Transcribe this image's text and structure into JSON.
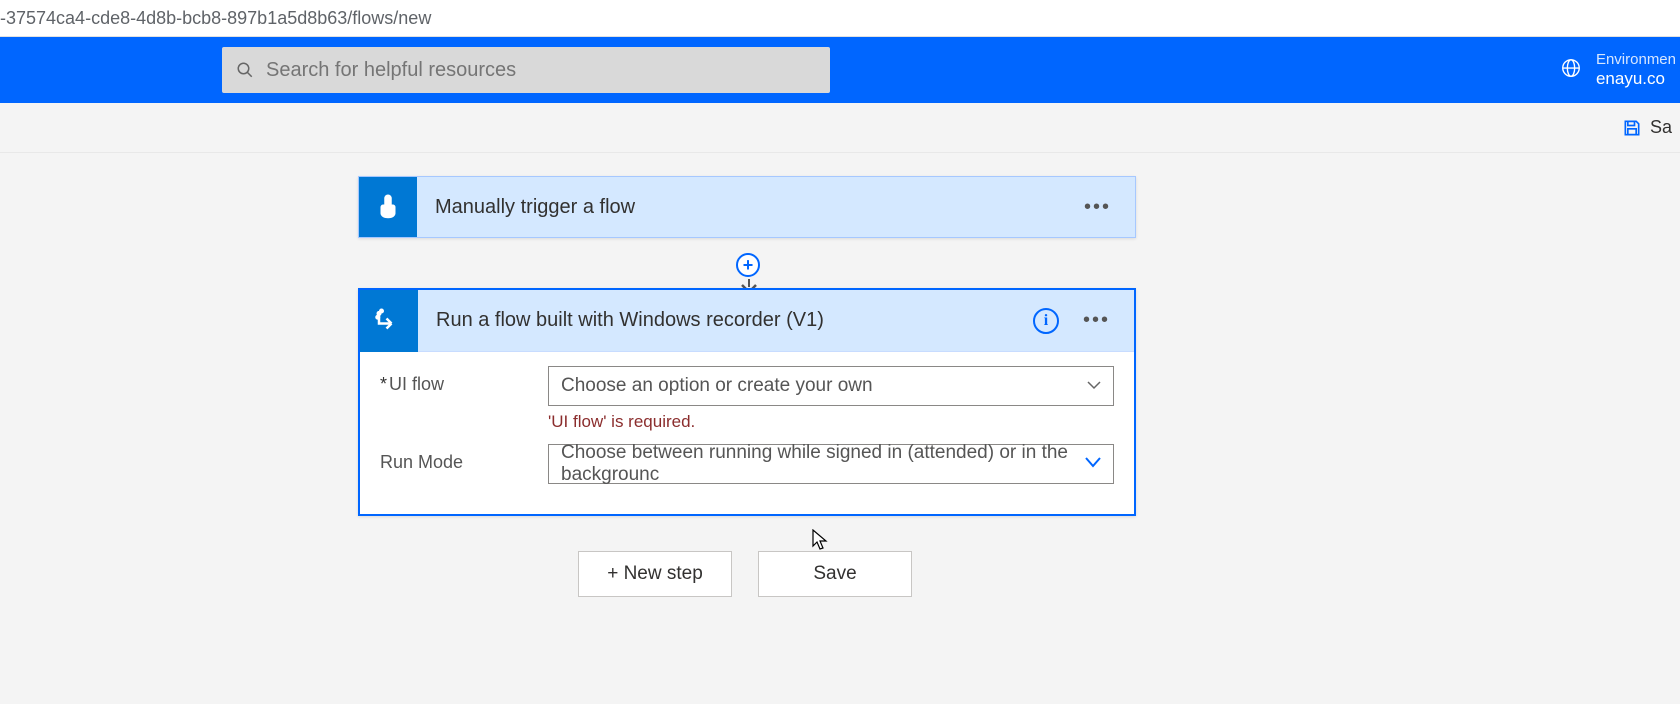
{
  "url_fragment": "-37574ca4-cde8-4d8b-bcb8-897b1a5d8b63/flows/new",
  "header": {
    "search_placeholder": "Search for helpful resources",
    "env_label": "Environmen",
    "env_value": "enayu.co"
  },
  "toolbar": {
    "save_label": "Sa"
  },
  "trigger": {
    "title": "Manually trigger a flow"
  },
  "action": {
    "title": "Run a flow built with Windows recorder (V1)",
    "fields": {
      "ui_flow_label": "UI flow",
      "ui_flow_placeholder": "Choose an option or create your own",
      "ui_flow_validation": "'UI flow' is required.",
      "run_mode_label": "Run Mode",
      "run_mode_placeholder": "Choose between running while signed in (attended) or in the backgrounc"
    }
  },
  "buttons": {
    "new_step": "+ New step",
    "save": "Save"
  }
}
